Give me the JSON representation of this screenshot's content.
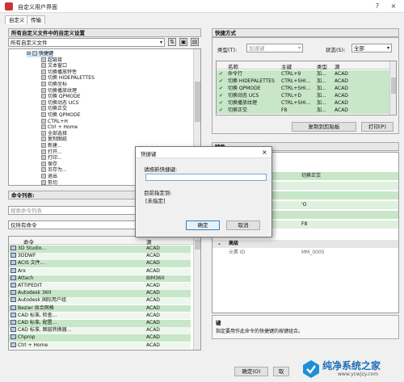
{
  "window": {
    "title": "自定义用户界面",
    "help": "?",
    "close": "×"
  },
  "tabs": [
    {
      "label": "自定义"
    },
    {
      "label": "传输"
    }
  ],
  "left_panel": {
    "header": "所有自定义文件中的自定义设置",
    "file_select": "所有自定义文件",
    "tree": [
      {
        "label": "快捷键",
        "level": 1,
        "expand": "⊟"
      },
      {
        "label": "超链接",
        "level": 2
      },
      {
        "label": "文本窗口",
        "level": 2
      },
      {
        "label": "切换播放特性",
        "level": 2
      },
      {
        "label": "切换 HIDEPALETTES",
        "level": 2
      },
      {
        "label": "切换坐标",
        "level": 2
      },
      {
        "label": "切换播放纹理",
        "level": 2
      },
      {
        "label": "切换 QPMODE",
        "level": 2
      },
      {
        "label": "切换动态 UCS",
        "level": 2
      },
      {
        "label": "切换正交",
        "level": 2
      },
      {
        "label": "切换 QPMODE",
        "level": 2
      },
      {
        "label": "CTRL+H",
        "level": 2
      },
      {
        "label": "Ctrl + Home",
        "level": 2
      },
      {
        "label": "全部选择",
        "level": 2
      },
      {
        "label": "复制图纸",
        "level": 2
      },
      {
        "label": "新建...",
        "level": 2
      },
      {
        "label": "打开...",
        "level": 2
      },
      {
        "label": "打印...",
        "level": 2
      },
      {
        "label": "保存",
        "level": 2
      },
      {
        "label": "另存为...",
        "level": 2
      },
      {
        "label": "退出",
        "level": 2
      },
      {
        "label": "剪切",
        "level": 2
      }
    ]
  },
  "command_list": {
    "header": "命令列表:",
    "search_placeholder": "搜索命令列表",
    "filter_select": "仅所有命令",
    "col_command": "命令",
    "col_source": "源",
    "rows": [
      {
        "name": "3D Studio...",
        "source": "ACAD"
      },
      {
        "name": "3DDWF",
        "source": "ACAD"
      },
      {
        "name": "ACIS 文件...",
        "source": "ACAD"
      },
      {
        "name": "Arx",
        "source": "ACAD"
      },
      {
        "name": "Attach",
        "source": "BIM360"
      },
      {
        "name": "ATTIPEDIT",
        "source": "ACAD"
      },
      {
        "name": "Autodesk 360",
        "source": "ACAD"
      },
      {
        "name": "Autodesk 国际用户组",
        "source": "ACAD"
      },
      {
        "name": "Bezier 拟合网格",
        "source": "ACAD"
      },
      {
        "name": "CAD 标准, 检查...",
        "source": "ACAD"
      },
      {
        "name": "CAD 标准, 配置...",
        "source": "ACAD"
      },
      {
        "name": "CAD 标准, 图层转换器...",
        "source": "ACAD"
      },
      {
        "name": "Chprop",
        "source": "ACAD"
      },
      {
        "name": "Ctrl + Home",
        "source": "ACAD"
      }
    ]
  },
  "shortcuts": {
    "header": "快捷方式",
    "type_label": "类型(T):",
    "type_value": "加速键",
    "status_label": "状态(S):",
    "status_value": "全部",
    "cols": [
      "名称",
      "主键",
      "类型",
      "源"
    ],
    "rows": [
      {
        "name": "命令行",
        "key": "CTRL+9",
        "type": "加...",
        "source": "ACAD"
      },
      {
        "name": "切换 HIDEPALETTES",
        "key": "CTRL+SHI...",
        "type": "加...",
        "source": "ACAD"
      },
      {
        "name": "切换 QPMODE",
        "key": "CTRL+SHI...",
        "type": "加...",
        "source": "ACAD"
      },
      {
        "name": "切换动态 UCS",
        "key": "CTRL+D",
        "type": "加...",
        "source": "ACAD"
      },
      {
        "name": "切换播放纹理",
        "key": "CTRL+SHI...",
        "type": "加...",
        "source": "ACAD"
      },
      {
        "name": "切换正交",
        "key": "F8",
        "type": "加...",
        "source": "ACAD"
      }
    ],
    "copy_button": "复制到剪贴板",
    "print_button": "打印(P)"
  },
  "properties": {
    "header": "特性",
    "rows": [
      {
        "label": "",
        "value": "切换正交"
      },
      {
        "label": "",
        "value": ""
      },
      {
        "label": "",
        "value": ""
      },
      {
        "label": "",
        "value": "'O"
      },
      {
        "label": "",
        "value": ""
      },
      {
        "label": "",
        "value": "F8"
      }
    ],
    "advanced_label": "高级",
    "element_id_label": "元素 ID",
    "element_id_value": "MM_0005",
    "desc_title": "键",
    "desc_text": "指定要用作此命令的快捷键的按键组合。"
  },
  "dialog": {
    "title": "快捷键",
    "close": "×",
    "prompt": "请按新快捷键:",
    "assigned_label": "目前指定到:",
    "assigned_value": "[未指定]",
    "ok": "确定",
    "cancel": "取消"
  },
  "footer": {
    "ok": "确定(O)",
    "cancel": "取"
  },
  "watermark": {
    "text_cn": "纯净系统之家",
    "text_url": "www.ycwjzy.com"
  }
}
